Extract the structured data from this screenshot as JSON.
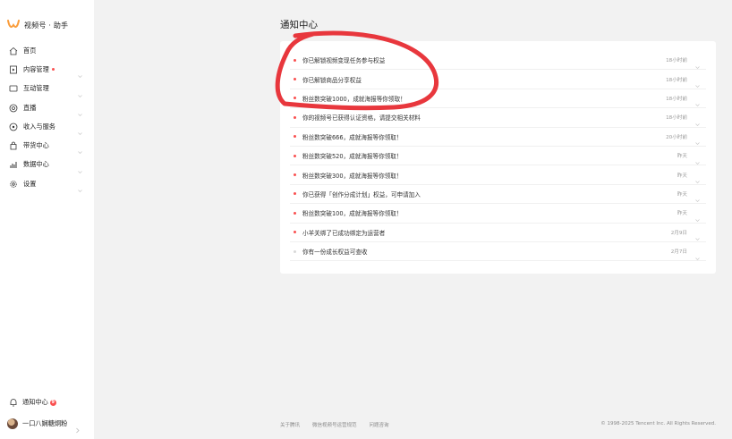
{
  "brand": {
    "name": "视频号 · 助手",
    "logo_color": "#fa9d3b"
  },
  "sidebar": {
    "items": [
      {
        "label": "首页",
        "icon": "home-icon",
        "chevron": false,
        "dot": false
      },
      {
        "label": "内容管理",
        "icon": "content-icon",
        "chevron": true,
        "dot": true
      },
      {
        "label": "互动管理",
        "icon": "interaction-icon",
        "chevron": true,
        "dot": false
      },
      {
        "label": "直播",
        "icon": "live-icon",
        "chevron": true,
        "dot": false
      },
      {
        "label": "收入与服务",
        "icon": "income-icon",
        "chevron": true,
        "dot": false
      },
      {
        "label": "带货中心",
        "icon": "shopping-bag-icon",
        "chevron": true,
        "dot": false
      },
      {
        "label": "数据中心",
        "icon": "data-icon",
        "chevron": true,
        "dot": false
      },
      {
        "label": "设置",
        "icon": "gear-icon",
        "chevron": true,
        "dot": false
      }
    ],
    "notice": {
      "label": "通知中心",
      "badge": "9"
    },
    "user": {
      "name": "一口八娴糖炯粉"
    }
  },
  "page": {
    "title": "通知中心"
  },
  "notifications": [
    {
      "text": "你已解锁视频变现任务参与权益",
      "time": "18小时前",
      "unread": true
    },
    {
      "text": "你已解锁商品分享权益",
      "time": "18小时前",
      "unread": true
    },
    {
      "text": "粉丝数突破1000，成就海报等你领取！",
      "time": "18小时前",
      "unread": true
    },
    {
      "text": "你的视频号已获得认证资格，请提交相关材料",
      "time": "18小时前",
      "unread": true
    },
    {
      "text": "粉丝数突破666，成就海报等你领取！",
      "time": "20小时前",
      "unread": true
    },
    {
      "text": "粉丝数突破520，成就海报等你领取！",
      "time": "昨天",
      "unread": true
    },
    {
      "text": "粉丝数突破300，成就海报等你领取！",
      "time": "昨天",
      "unread": true
    },
    {
      "text": "你已获得「创作分成计划」权益，可申请加入",
      "time": "昨天",
      "unread": true
    },
    {
      "text": "粉丝数突破100，成就海报等你领取！",
      "time": "昨天",
      "unread": true
    },
    {
      "text": "小羊关绑了已成功绑定为运营者",
      "time": "2月9日",
      "unread": true
    },
    {
      "text": "你有一份成长权益可查收",
      "time": "2月7日",
      "unread": false
    }
  ],
  "footer": {
    "links": [
      "关于腾讯",
      "微信视频号运营规范",
      "问题咨询"
    ],
    "copyright": "© 1998-2025 Tencent Inc. All Rights Reserved."
  },
  "colors": {
    "unread_dot": "#fa5151",
    "annotation": "#e8373d",
    "background": "#f2f2f2"
  }
}
